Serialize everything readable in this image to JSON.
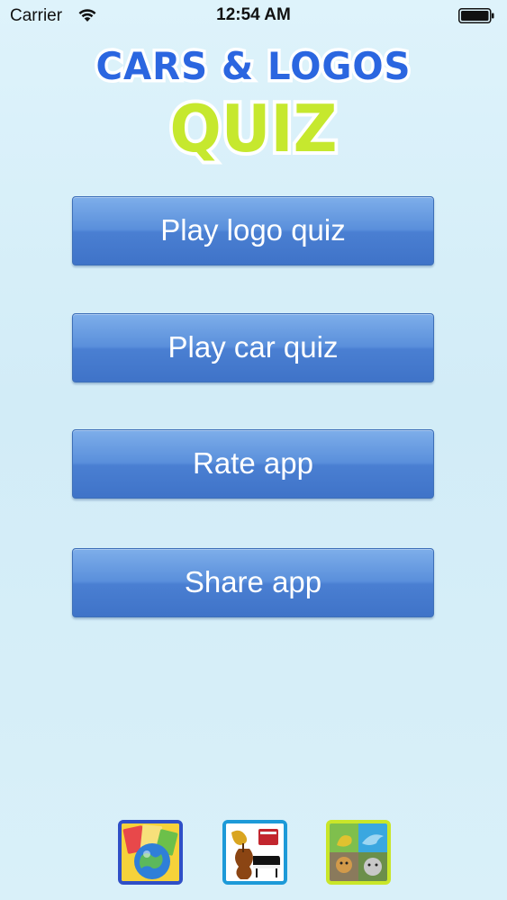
{
  "status_bar": {
    "carrier": "Carrier",
    "time": "12:54 AM",
    "wifi_icon": "wifi-icon",
    "battery_icon": "battery-full-icon"
  },
  "title": {
    "line1": "CARS & LOGOS",
    "line2": "QUIZ",
    "line1_color": "#2b66e0",
    "line2_color": "#c6e82e"
  },
  "buttons": {
    "play_logo_quiz": "Play logo quiz",
    "play_car_quiz": "Play car quiz",
    "rate_app": "Rate app",
    "share_app": "Share app"
  },
  "colors": {
    "button_blue": "#4a7fd2",
    "background": "#d6eef8"
  },
  "promo_apps": [
    {
      "icon": "world-flags-app-icon"
    },
    {
      "icon": "musical-instruments-app-icon"
    },
    {
      "icon": "animals-app-icon"
    }
  ]
}
